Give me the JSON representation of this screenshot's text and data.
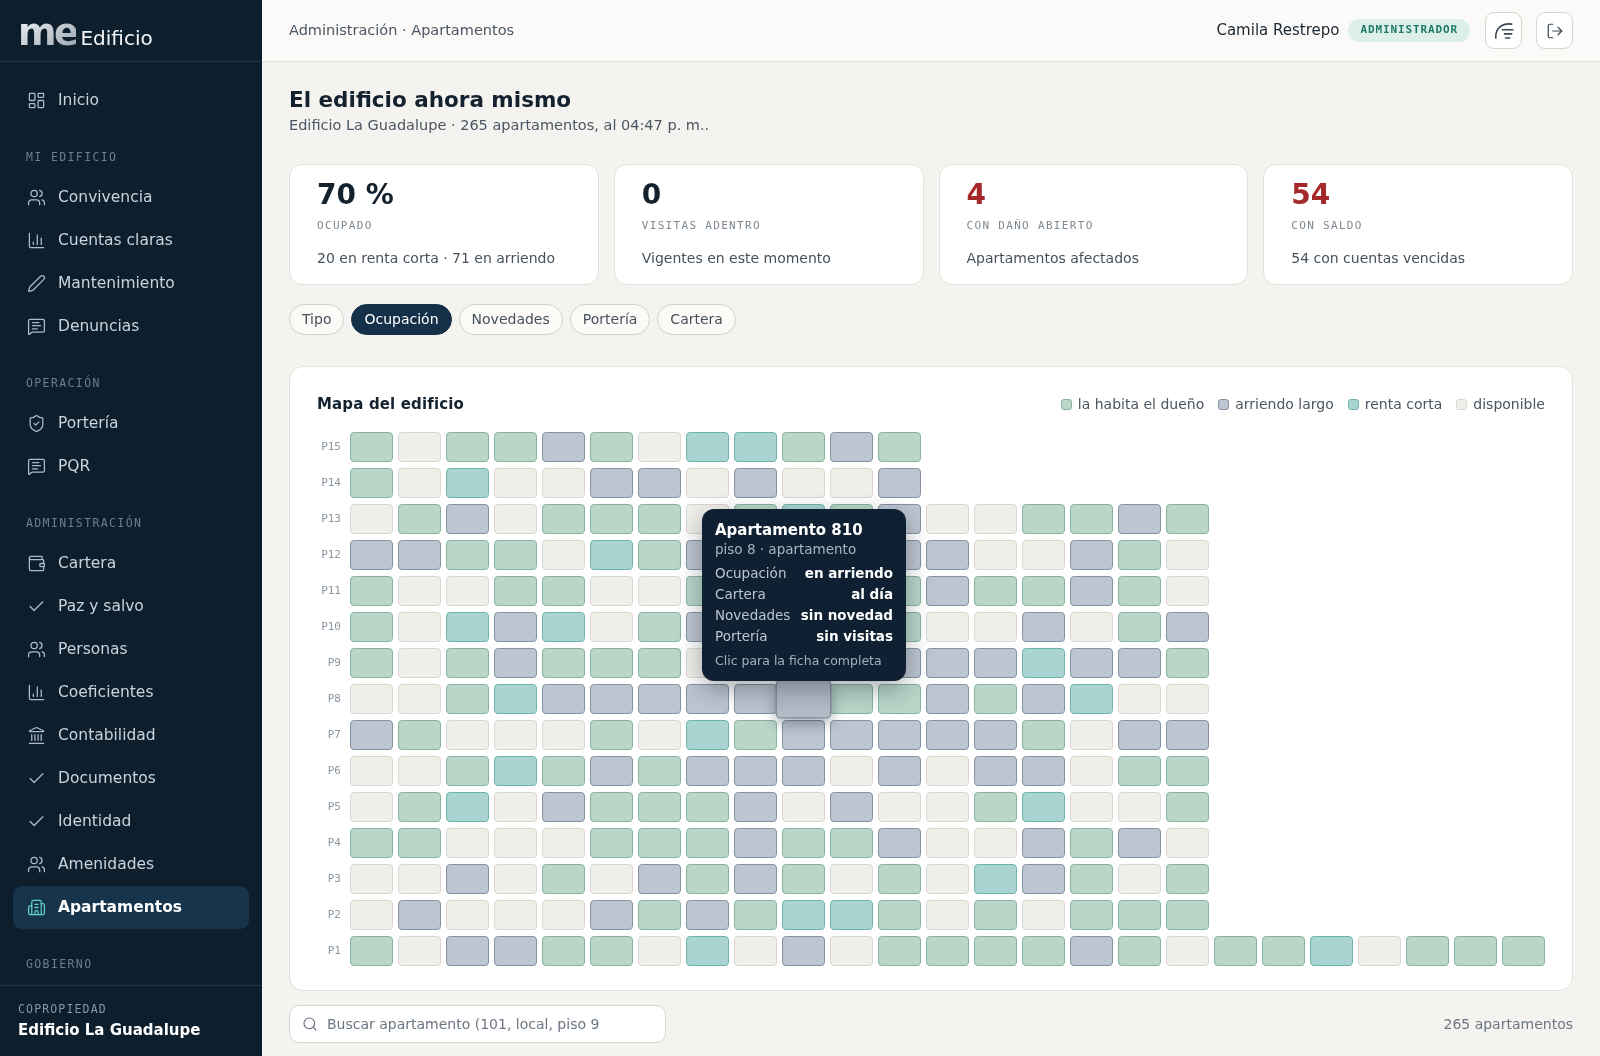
{
  "sidebar": {
    "logo": {
      "mark": "me",
      "name": "Edificio"
    },
    "sections": [
      {
        "items": [
          {
            "label": "Inicio",
            "selected": false
          }
        ]
      },
      {
        "heading": "MI EDIFICIO",
        "items": [
          {
            "label": "Convivencia",
            "selected": false
          },
          {
            "label": "Cuentas claras",
            "selected": false
          },
          {
            "label": "Mantenimiento",
            "selected": false
          },
          {
            "label": "Denuncias",
            "selected": false
          }
        ]
      },
      {
        "heading": "OPERACIÓN",
        "items": [
          {
            "label": "Portería",
            "selected": false
          },
          {
            "label": "PQR",
            "selected": false
          }
        ]
      },
      {
        "heading": "ADMINISTRACIÓN",
        "items": [
          {
            "label": "Cartera",
            "selected": false
          },
          {
            "label": "Paz y salvo",
            "selected": false
          },
          {
            "label": "Personas",
            "selected": false
          },
          {
            "label": "Coeficientes",
            "selected": false
          },
          {
            "label": "Contabilidad",
            "selected": false
          },
          {
            "label": "Documentos",
            "selected": false
          },
          {
            "label": "Identidad",
            "selected": false
          },
          {
            "label": "Amenidades",
            "selected": false
          },
          {
            "label": "Apartamentos",
            "selected": true
          }
        ]
      },
      {
        "heading": "GOBIERNO"
      }
    ],
    "footer": {
      "caption": "COPROPIEDAD",
      "name": "Edificio La Guadalupe"
    }
  },
  "header": {
    "breadcrumb": "Administración · Apartamentos",
    "user": "Camila Restrepo",
    "role": "ADMINISTRADOR"
  },
  "page": {
    "title": "El edificio ahora mismo",
    "subtitle": "Edificio La Guadalupe · 265 apartamentos, al 04:47 p. m.."
  },
  "stats": [
    {
      "value": "70 %",
      "label": "OCUPADO",
      "note": "20 en renta corta · 71 en arriendo",
      "color": "#14222f"
    },
    {
      "value": "0",
      "label": "VISITAS ADENTRO",
      "note": "Vigentes en este momento",
      "color": "#14222f"
    },
    {
      "value": "4",
      "label": "CON DAÑO ABIERTO",
      "note": "Apartamentos afectados",
      "color": "#a5282b"
    },
    {
      "value": "54",
      "label": "CON SALDO",
      "note": "54 con cuentas vencidas",
      "color": "#a5282b"
    }
  ],
  "filters": [
    {
      "label": "Tipo",
      "selected": false
    },
    {
      "label": "Ocupación",
      "selected": true
    },
    {
      "label": "Novedades",
      "selected": false
    },
    {
      "label": "Portería",
      "selected": false
    },
    {
      "label": "Cartera",
      "selected": false
    }
  ],
  "map": {
    "title": "Mapa del edificio",
    "legend": [
      {
        "label": "la habita el dueño",
        "kind": "owner"
      },
      {
        "label": "arriendo largo",
        "kind": "lease"
      },
      {
        "label": "renta corta",
        "kind": "shortstay"
      },
      {
        "label": "disponible",
        "kind": "vacant"
      }
    ],
    "floors": [
      {
        "label": "P15",
        "units": [
          {
            "kind": "owner",
            "selected": false
          },
          {
            "kind": "vacant",
            "selected": false
          },
          {
            "kind": "owner",
            "selected": false
          },
          {
            "kind": "owner",
            "selected": false
          },
          {
            "kind": "lease",
            "selected": false
          },
          {
            "kind": "owner",
            "selected": false
          },
          {
            "kind": "vacant",
            "selected": false
          },
          {
            "kind": "shortstay",
            "selected": false
          },
          {
            "kind": "shortstay",
            "selected": false
          },
          {
            "kind": "owner",
            "selected": false
          },
          {
            "kind": "lease",
            "selected": false
          },
          {
            "kind": "owner",
            "selected": false
          }
        ]
      },
      {
        "label": "P14",
        "units": [
          {
            "kind": "owner",
            "selected": false
          },
          {
            "kind": "vacant",
            "selected": false
          },
          {
            "kind": "shortstay",
            "selected": false
          },
          {
            "kind": "vacant",
            "selected": false
          },
          {
            "kind": "vacant",
            "selected": false
          },
          {
            "kind": "lease",
            "selected": false
          },
          {
            "kind": "lease",
            "selected": false
          },
          {
            "kind": "vacant",
            "selected": false
          },
          {
            "kind": "lease",
            "selected": false
          },
          {
            "kind": "vacant",
            "selected": false
          },
          {
            "kind": "vacant",
            "selected": false
          },
          {
            "kind": "lease",
            "selected": false
          }
        ]
      },
      {
        "label": "P13",
        "units": [
          {
            "kind": "vacant",
            "selected": false
          },
          {
            "kind": "owner",
            "selected": false
          },
          {
            "kind": "lease",
            "selected": false
          },
          {
            "kind": "vacant",
            "selected": false
          },
          {
            "kind": "owner",
            "selected": false
          },
          {
            "kind": "owner",
            "selected": false
          },
          {
            "kind": "owner",
            "selected": false
          },
          {
            "kind": "vacant",
            "selected": false
          },
          {
            "kind": "owner",
            "selected": false
          },
          {
            "kind": "shortstay",
            "selected": false
          },
          {
            "kind": "owner",
            "selected": false
          },
          {
            "kind": "lease",
            "selected": false
          },
          {
            "kind": "vacant",
            "selected": false
          },
          {
            "kind": "vacant",
            "selected": false
          },
          {
            "kind": "owner",
            "selected": false
          },
          {
            "kind": "owner",
            "selected": false
          },
          {
            "kind": "lease",
            "selected": false
          },
          {
            "kind": "owner",
            "selected": false
          }
        ]
      },
      {
        "label": "P12",
        "units": [
          {
            "kind": "lease",
            "selected": false
          },
          {
            "kind": "lease",
            "selected": false
          },
          {
            "kind": "owner",
            "selected": false
          },
          {
            "kind": "owner",
            "selected": false
          },
          {
            "kind": "vacant",
            "selected": false
          },
          {
            "kind": "shortstay",
            "selected": false
          },
          {
            "kind": "owner",
            "selected": false
          },
          {
            "kind": "lease",
            "selected": false
          }
        ],
        "units_right": [
          {
            "kind": "lease",
            "selected": false
          },
          {
            "kind": "lease",
            "selected": false
          },
          {
            "kind": "vacant",
            "selected": false
          },
          {
            "kind": "vacant",
            "selected": false
          },
          {
            "kind": "lease",
            "selected": false
          },
          {
            "kind": "owner",
            "selected": false
          },
          {
            "kind": "vacant",
            "selected": false
          }
        ]
      },
      {
        "label": "P11",
        "units": [
          {
            "kind": "owner",
            "selected": false
          },
          {
            "kind": "vacant",
            "selected": false
          },
          {
            "kind": "vacant",
            "selected": false
          },
          {
            "kind": "owner",
            "selected": false
          },
          {
            "kind": "owner",
            "selected": false
          },
          {
            "kind": "vacant",
            "selected": false
          },
          {
            "kind": "vacant",
            "selected": false
          },
          {
            "kind": "owner",
            "selected": false
          }
        ],
        "units_right": [
          {
            "kind": "owner",
            "selected": false
          },
          {
            "kind": "lease",
            "selected": false
          },
          {
            "kind": "owner",
            "selected": false
          },
          {
            "kind": "owner",
            "selected": false
          },
          {
            "kind": "lease",
            "selected": false
          },
          {
            "kind": "owner",
            "selected": false
          },
          {
            "kind": "vacant",
            "selected": false
          }
        ]
      },
      {
        "label": "P10",
        "units": [
          {
            "kind": "owner",
            "selected": false
          },
          {
            "kind": "vacant",
            "selected": false
          },
          {
            "kind": "shortstay",
            "selected": false
          },
          {
            "kind": "lease",
            "selected": false
          },
          {
            "kind": "shortstay",
            "selected": false
          },
          {
            "kind": "vacant",
            "selected": false
          },
          {
            "kind": "owner",
            "selected": false
          },
          {
            "kind": "lease",
            "selected": false
          }
        ],
        "units_right": [
          {
            "kind": "owner",
            "selected": false
          },
          {
            "kind": "vacant",
            "selected": false
          },
          {
            "kind": "vacant",
            "selected": false
          },
          {
            "kind": "lease",
            "selected": false
          },
          {
            "kind": "vacant",
            "selected": false
          },
          {
            "kind": "owner",
            "selected": false
          },
          {
            "kind": "lease",
            "selected": false
          }
        ]
      },
      {
        "label": "P9",
        "units": [
          {
            "kind": "owner",
            "selected": false
          },
          {
            "kind": "vacant",
            "selected": false
          },
          {
            "kind": "owner",
            "selected": false
          },
          {
            "kind": "lease",
            "selected": false
          },
          {
            "kind": "owner",
            "selected": false
          },
          {
            "kind": "owner",
            "selected": false
          },
          {
            "kind": "owner",
            "selected": false
          },
          {
            "kind": "vacant",
            "selected": false
          }
        ],
        "units_right": [
          {
            "kind": "lease",
            "selected": false
          },
          {
            "kind": "lease",
            "selected": false
          },
          {
            "kind": "lease",
            "selected": false
          },
          {
            "kind": "shortstay",
            "selected": false
          },
          {
            "kind": "lease",
            "selected": false
          },
          {
            "kind": "lease",
            "selected": false
          },
          {
            "kind": "owner",
            "selected": false
          }
        ]
      },
      {
        "label": "P8",
        "units": [
          {
            "kind": "vacant",
            "selected": false
          },
          {
            "kind": "vacant",
            "selected": false
          },
          {
            "kind": "owner",
            "selected": false
          },
          {
            "kind": "shortstay",
            "selected": false
          },
          {
            "kind": "lease",
            "selected": false
          },
          {
            "kind": "lease",
            "selected": false
          },
          {
            "kind": "lease",
            "selected": false
          },
          {
            "kind": "lease",
            "selected": false
          },
          {
            "kind": "lease",
            "selected": false
          },
          {
            "kind": "lease",
            "selected": true
          },
          {
            "kind": "owner",
            "selected": false
          },
          {
            "kind": "owner",
            "selected": false
          },
          {
            "kind": "lease",
            "selected": false
          },
          {
            "kind": "owner",
            "selected": false
          },
          {
            "kind": "lease",
            "selected": false
          },
          {
            "kind": "shortstay",
            "selected": false
          },
          {
            "kind": "vacant",
            "selected": false
          },
          {
            "kind": "vacant",
            "selected": false
          }
        ]
      },
      {
        "label": "P7",
        "units": [
          {
            "kind": "lease",
            "selected": false
          },
          {
            "kind": "owner",
            "selected": false
          },
          {
            "kind": "vacant",
            "selected": false
          },
          {
            "kind": "vacant",
            "selected": false
          },
          {
            "kind": "vacant",
            "selected": false
          },
          {
            "kind": "owner",
            "selected": false
          },
          {
            "kind": "vacant",
            "selected": false
          },
          {
            "kind": "shortstay",
            "selected": false
          },
          {
            "kind": "owner",
            "selected": false
          },
          {
            "kind": "lease",
            "selected": false
          },
          {
            "kind": "lease",
            "selected": false
          },
          {
            "kind": "lease",
            "selected": false
          },
          {
            "kind": "lease",
            "selected": false
          },
          {
            "kind": "lease",
            "selected": false
          },
          {
            "kind": "owner",
            "selected": false
          },
          {
            "kind": "vacant",
            "selected": false
          },
          {
            "kind": "lease",
            "selected": false
          },
          {
            "kind": "lease",
            "selected": false
          }
        ]
      },
      {
        "label": "P6",
        "units": [
          {
            "kind": "vacant",
            "selected": false
          },
          {
            "kind": "vacant",
            "selected": false
          },
          {
            "kind": "owner",
            "selected": false
          },
          {
            "kind": "shortstay",
            "selected": false
          },
          {
            "kind": "owner",
            "selected": false
          },
          {
            "kind": "lease",
            "selected": false
          },
          {
            "kind": "owner",
            "selected": false
          },
          {
            "kind": "lease",
            "selected": false
          },
          {
            "kind": "lease",
            "selected": false
          },
          {
            "kind": "lease",
            "selected": false
          },
          {
            "kind": "vacant",
            "selected": false
          },
          {
            "kind": "lease",
            "selected": false
          },
          {
            "kind": "vacant",
            "selected": false
          },
          {
            "kind": "lease",
            "selected": false
          },
          {
            "kind": "lease",
            "selected": false
          },
          {
            "kind": "vacant",
            "selected": false
          },
          {
            "kind": "owner",
            "selected": false
          },
          {
            "kind": "owner",
            "selected": false
          }
        ]
      },
      {
        "label": "P5",
        "units": [
          {
            "kind": "vacant",
            "selected": false
          },
          {
            "kind": "owner",
            "selected": false
          },
          {
            "kind": "shortstay",
            "selected": false
          },
          {
            "kind": "vacant",
            "selected": false
          },
          {
            "kind": "lease",
            "selected": false
          },
          {
            "kind": "owner",
            "selected": false
          },
          {
            "kind": "owner",
            "selected": false
          },
          {
            "kind": "owner",
            "selected": false
          },
          {
            "kind": "lease",
            "selected": false
          },
          {
            "kind": "vacant",
            "selected": false
          },
          {
            "kind": "lease",
            "selected": false
          },
          {
            "kind": "vacant",
            "selected": false
          },
          {
            "kind": "vacant",
            "selected": false
          },
          {
            "kind": "owner",
            "selected": false
          },
          {
            "kind": "shortstay",
            "selected": false
          },
          {
            "kind": "vacant",
            "selected": false
          },
          {
            "kind": "vacant",
            "selected": false
          },
          {
            "kind": "owner",
            "selected": false
          }
        ]
      },
      {
        "label": "P4",
        "units": [
          {
            "kind": "owner",
            "selected": false
          },
          {
            "kind": "owner",
            "selected": false
          },
          {
            "kind": "vacant",
            "selected": false
          },
          {
            "kind": "vacant",
            "selected": false
          },
          {
            "kind": "vacant",
            "selected": false
          },
          {
            "kind": "owner",
            "selected": false
          },
          {
            "kind": "owner",
            "selected": false
          },
          {
            "kind": "owner",
            "selected": false
          },
          {
            "kind": "lease",
            "selected": false
          },
          {
            "kind": "owner",
            "selected": false
          },
          {
            "kind": "owner",
            "selected": false
          },
          {
            "kind": "lease",
            "selected": false
          },
          {
            "kind": "vacant",
            "selected": false
          },
          {
            "kind": "vacant",
            "selected": false
          },
          {
            "kind": "lease",
            "selected": false
          },
          {
            "kind": "owner",
            "selected": false
          },
          {
            "kind": "lease",
            "selected": false
          },
          {
            "kind": "vacant",
            "selected": false
          }
        ]
      },
      {
        "label": "P3",
        "units": [
          {
            "kind": "vacant",
            "selected": false
          },
          {
            "kind": "vacant",
            "selected": false
          },
          {
            "kind": "lease",
            "selected": false
          },
          {
            "kind": "vacant",
            "selected": false
          },
          {
            "kind": "owner",
            "selected": false
          },
          {
            "kind": "vacant",
            "selected": false
          },
          {
            "kind": "lease",
            "selected": false
          },
          {
            "kind": "owner",
            "selected": false
          },
          {
            "kind": "lease",
            "selected": false
          },
          {
            "kind": "owner",
            "selected": false
          },
          {
            "kind": "vacant",
            "selected": false
          },
          {
            "kind": "owner",
            "selected": false
          },
          {
            "kind": "vacant",
            "selected": false
          },
          {
            "kind": "shortstay",
            "selected": false
          },
          {
            "kind": "lease",
            "selected": false
          },
          {
            "kind": "owner",
            "selected": false
          },
          {
            "kind": "vacant",
            "selected": false
          },
          {
            "kind": "owner",
            "selected": false
          }
        ]
      },
      {
        "label": "P2",
        "units": [
          {
            "kind": "vacant",
            "selected": false
          },
          {
            "kind": "lease",
            "selected": false
          },
          {
            "kind": "vacant",
            "selected": false
          },
          {
            "kind": "vacant",
            "selected": false
          },
          {
            "kind": "vacant",
            "selected": false
          },
          {
            "kind": "lease",
            "selected": false
          },
          {
            "kind": "owner",
            "selected": false
          },
          {
            "kind": "lease",
            "selected": false
          },
          {
            "kind": "owner",
            "selected": false
          },
          {
            "kind": "shortstay",
            "selected": false
          },
          {
            "kind": "shortstay",
            "selected": false
          },
          {
            "kind": "owner",
            "selected": false
          },
          {
            "kind": "vacant",
            "selected": false
          },
          {
            "kind": "owner",
            "selected": false
          },
          {
            "kind": "vacant",
            "selected": false
          },
          {
            "kind": "owner",
            "selected": false
          },
          {
            "kind": "owner",
            "selected": false
          },
          {
            "kind": "owner",
            "selected": false
          }
        ]
      },
      {
        "label": "P1",
        "units": [
          {
            "kind": "owner",
            "selected": false
          },
          {
            "kind": "vacant",
            "selected": false
          },
          {
            "kind": "lease",
            "selected": false
          },
          {
            "kind": "lease",
            "selected": false
          },
          {
            "kind": "owner",
            "selected": false
          },
          {
            "kind": "owner",
            "selected": false
          },
          {
            "kind": "vacant",
            "selected": false
          },
          {
            "kind": "shortstay",
            "selected": false
          },
          {
            "kind": "vacant",
            "selected": false
          },
          {
            "kind": "lease",
            "selected": false
          },
          {
            "kind": "vacant",
            "selected": false
          },
          {
            "kind": "owner",
            "selected": false
          },
          {
            "kind": "owner",
            "selected": false
          },
          {
            "kind": "owner",
            "selected": false
          },
          {
            "kind": "owner",
            "selected": false
          },
          {
            "kind": "lease",
            "selected": false
          },
          {
            "kind": "owner",
            "selected": false
          },
          {
            "kind": "vacant",
            "selected": false
          },
          {
            "kind": "owner",
            "selected": false
          },
          {
            "kind": "owner",
            "selected": false
          },
          {
            "kind": "shortstay",
            "selected": false
          },
          {
            "kind": "vacant",
            "selected": false
          },
          {
            "kind": "owner",
            "selected": false
          },
          {
            "kind": "owner",
            "selected": false
          },
          {
            "kind": "owner",
            "selected": false
          }
        ]
      }
    ],
    "tooltip": {
      "title": "Apartamento 810",
      "subtitle": "piso 8 · apartamento",
      "rows": [
        {
          "label": "Ocupación",
          "value": "en arriendo"
        },
        {
          "label": "Cartera",
          "value": "al día"
        },
        {
          "label": "Novedades",
          "value": "sin novedad"
        },
        {
          "label": "Portería",
          "value": "sin visitas"
        }
      ],
      "hint": "Clic para la ficha completa"
    }
  },
  "search": {
    "placeholder": "Buscar apartamento (101, local, piso 9"
  },
  "count": "265 apartamentos"
}
